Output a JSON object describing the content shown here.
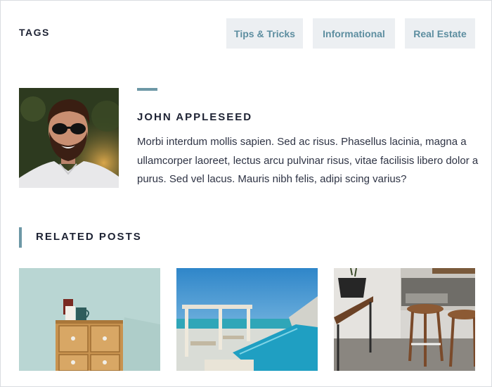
{
  "tags": {
    "title": "TAGS",
    "items": [
      "Tips & Tricks",
      "Informational",
      "Real Estate"
    ]
  },
  "author": {
    "name": "JOHN APPLESEED",
    "bio": "Morbi interdum mollis sapien. Sed ac risus. Phasellus lacinia, magna a ullamcorper laoreet, lectus arcu pulvinar risus, vitae facilisis libero dolor a purus. Sed vel lacus. Mauris nibh felis, adipi scing varius?"
  },
  "related": {
    "title": "RELATED POSTS",
    "posts": [
      {
        "thumbnail": "dresser-with-mugs-photo"
      },
      {
        "thumbnail": "pool-with-pergola-photo"
      },
      {
        "thumbnail": "cafe-table-and-stools-photo"
      }
    ]
  },
  "colors": {
    "accent": "#6d98a6",
    "tag_bg": "#eceff2",
    "tag_text": "#5d8ea0",
    "heading": "#1d2233"
  }
}
